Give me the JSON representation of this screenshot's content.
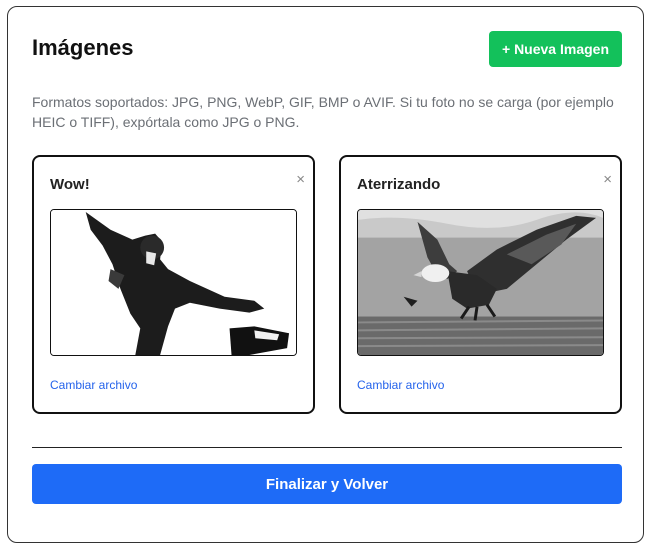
{
  "page": {
    "title": "Imágenes",
    "new_button": "+ Nueva Imagen",
    "help_text": "Formatos soportados: JPG, PNG, WebP, GIF, BMP o AVIF. Si tu foto no se carga (por ejemplo HEIC o TIFF), expórtala como JPG o PNG.",
    "finish_button": "Finalizar y Volver"
  },
  "cards": [
    {
      "title": "Wow!",
      "close": "×",
      "change_label": "Cambiar archivo",
      "image": "person-jumping-photo"
    },
    {
      "title": "Aterrizando",
      "close": "×",
      "change_label": "Cambiar archivo",
      "image": "eagle-landing-photo"
    }
  ],
  "colors": {
    "new_button": "#13c15b",
    "finish_button": "#1e6bf7",
    "link": "#2563eb",
    "help_text": "#6b6f75"
  }
}
